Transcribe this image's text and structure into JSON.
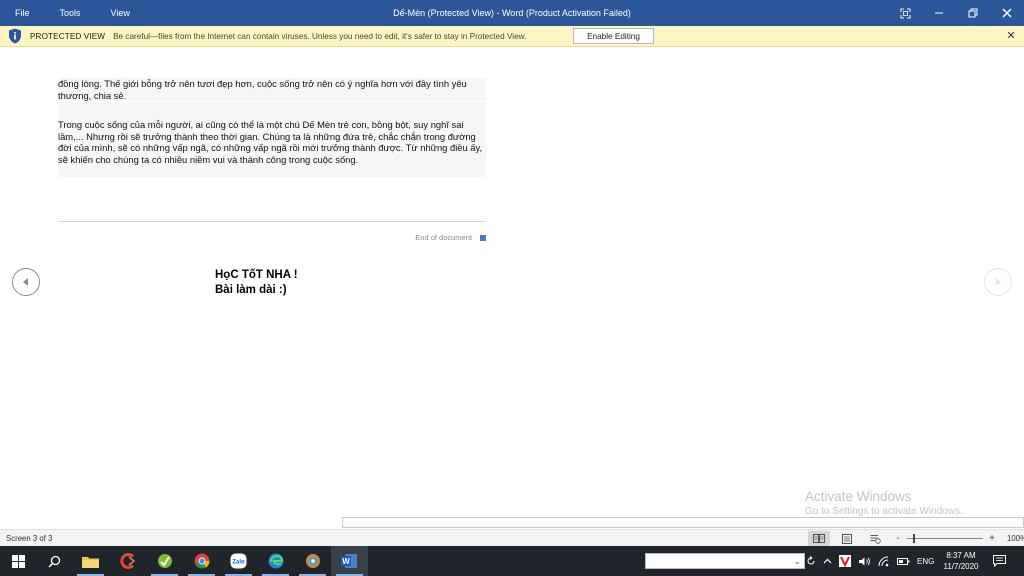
{
  "titlebar": {
    "menu": [
      "File",
      "Tools",
      "View"
    ],
    "title": "Dế-Mèn (Protected View) - Word (Product Activation Failed)",
    "bg_color": "#2b579a"
  },
  "protected_view": {
    "label": "PROTECTED VIEW",
    "message": "Be careful—files from the Internet can contain viruses. Unless you need to edit, it's safer to stay in Protected View.",
    "button_label": "Enable Editing",
    "close_label": "✕"
  },
  "document": {
    "paragraph_1": "đồng lòng. Thế giới bỗng trở nên tươi đẹp hơn, cuộc sống trở nên có ý nghĩa hơn với đầy tình yêu thương, chia sẻ.",
    "paragraph_2": "Trong cuộc sống của mỗi người, ai cũng có thể là một chú Dế Mèn trẻ con, bồng bột, suy nghĩ sai lầm,... Nhưng rồi sẽ trưởng thành theo thời gian. Chúng ta là những đứa trẻ, chắc chắn trong đường đời của mình, sẽ có những vấp ngã, có những vấp ngã rồi mới trưởng thành được. Từ những điều ấy, sẽ khiến cho chúng ta có nhiều niềm vui và thành công trong cuộc sống.",
    "end_of_document": "End of document"
  },
  "annotation": {
    "line_1": "HọC TốT NHA !",
    "line_2": "Bài làm dài :)"
  },
  "watermark": {
    "line_1": "Activate Windows",
    "line_2": "Go to Settings to activate Windows."
  },
  "statusbar": {
    "screen_count": "Screen 3 of 3",
    "zoom_level": "100%",
    "zoom_minus": "-",
    "zoom_plus": "+"
  },
  "taskbar": {
    "language": "ENG",
    "time": "8:37 AM",
    "date": "11/7/2020",
    "apps": [
      "file-explorer-icon",
      "ccleaner-icon",
      "app-green-icon",
      "chrome-icon",
      "zalo-icon",
      "edge-icon",
      "app-dragon-icon",
      "word-icon"
    ],
    "zalo_label": "Zalo",
    "word_label": "W"
  }
}
